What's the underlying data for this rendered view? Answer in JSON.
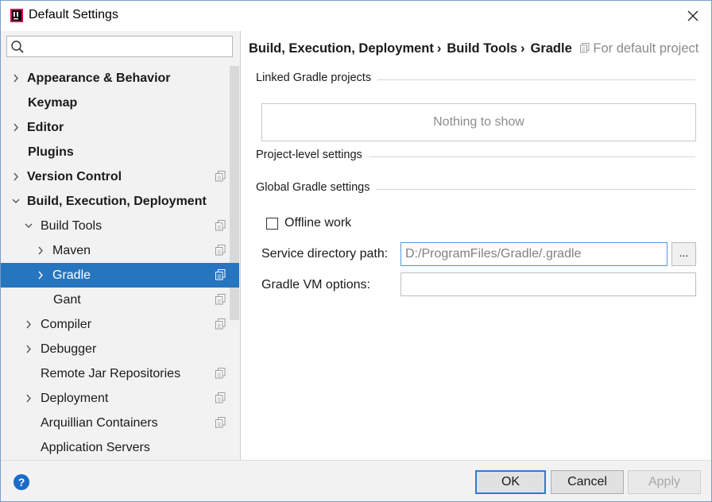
{
  "window": {
    "title": "Default Settings"
  },
  "search": {
    "placeholder": ""
  },
  "tree": {
    "items": [
      {
        "label": "Appearance & Behavior",
        "bold": true,
        "expandable": true,
        "expanded": false,
        "copy": false,
        "depth": 0
      },
      {
        "label": "Keymap",
        "bold": true,
        "expandable": false,
        "copy": false,
        "depth": 0
      },
      {
        "label": "Editor",
        "bold": true,
        "expandable": true,
        "expanded": false,
        "copy": false,
        "depth": 0
      },
      {
        "label": "Plugins",
        "bold": true,
        "expandable": false,
        "copy": false,
        "depth": 0
      },
      {
        "label": "Version Control",
        "bold": true,
        "expandable": true,
        "expanded": false,
        "copy": true,
        "depth": 0
      },
      {
        "label": "Build, Execution, Deployment",
        "bold": true,
        "expandable": true,
        "expanded": true,
        "copy": false,
        "depth": 0
      },
      {
        "label": "Build Tools",
        "bold": false,
        "expandable": true,
        "expanded": true,
        "copy": true,
        "depth": 1
      },
      {
        "label": "Maven",
        "bold": false,
        "expandable": true,
        "expanded": false,
        "copy": true,
        "depth": 2
      },
      {
        "label": "Gradle",
        "bold": false,
        "expandable": true,
        "expanded": false,
        "copy": true,
        "depth": 2,
        "selected": true
      },
      {
        "label": "Gant",
        "bold": false,
        "expandable": false,
        "copy": true,
        "depth": 2
      },
      {
        "label": "Compiler",
        "bold": false,
        "expandable": true,
        "expanded": false,
        "copy": true,
        "depth": 1
      },
      {
        "label": "Debugger",
        "bold": false,
        "expandable": true,
        "expanded": false,
        "copy": false,
        "depth": 1
      },
      {
        "label": "Remote Jar Repositories",
        "bold": false,
        "expandable": false,
        "copy": true,
        "depth": 1
      },
      {
        "label": "Deployment",
        "bold": false,
        "expandable": true,
        "expanded": false,
        "copy": true,
        "depth": 1
      },
      {
        "label": "Arquillian Containers",
        "bold": false,
        "expandable": false,
        "copy": true,
        "depth": 1
      },
      {
        "label": "Application Servers",
        "bold": false,
        "expandable": false,
        "copy": false,
        "depth": 1
      }
    ]
  },
  "breadcrumb": {
    "items": [
      "Build, Execution, Deployment",
      "Build Tools",
      "Gradle"
    ],
    "separator": "›",
    "note": "For default project"
  },
  "sections": {
    "linked": "Linked Gradle projects",
    "project_level": "Project-level settings",
    "global": "Global Gradle settings"
  },
  "linked_projects": {
    "empty_text": "Nothing to show"
  },
  "offline": {
    "label": "Offline work",
    "checked": false
  },
  "service_dir": {
    "label": "Service directory path:",
    "value": "D:/ProgramFiles/Gradle/.gradle",
    "browse": "..."
  },
  "vm_options": {
    "label": "Gradle VM options:",
    "value": ""
  },
  "footer": {
    "help": "?",
    "ok": "OK",
    "cancel": "Cancel",
    "apply": "Apply"
  },
  "colors": {
    "selection": "#2675bf",
    "accent": "#2c7ad6",
    "help": "#1a6cc8"
  }
}
